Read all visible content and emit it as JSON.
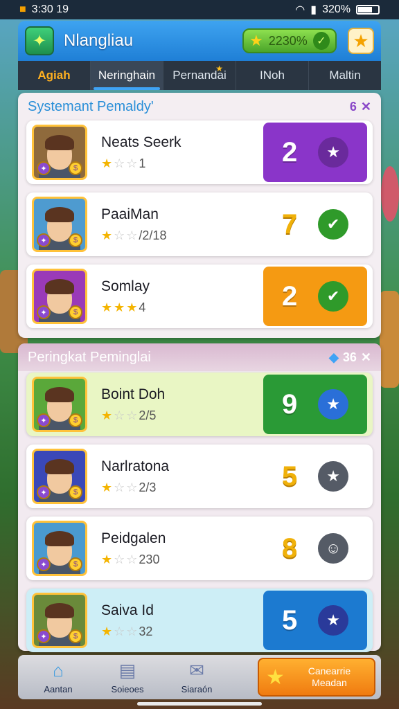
{
  "status": {
    "time": "3:30 19",
    "battery": "320%"
  },
  "header": {
    "title": "Nlangliau",
    "currency_value": "2230%",
    "app_icon": "leaf-star-icon",
    "fav_icon": "star-icon"
  },
  "tabs": [
    {
      "label": "Agiah"
    },
    {
      "label": "Neringhain"
    },
    {
      "label": "Pernandai"
    },
    {
      "label": "INoh"
    },
    {
      "label": "Maltin"
    }
  ],
  "panel1": {
    "title": "Systemant Pemaldy'",
    "close_count": "6",
    "rows": [
      {
        "name": "Neats Seerk",
        "rating": "1",
        "stars": 1,
        "score": "2",
        "score_color": "#8a35c9",
        "medal_color": "#6a2a9c",
        "medal_icon": "star-icon",
        "boxed": true,
        "avatar_bg": "#8f6a3c"
      },
      {
        "name": "PaaiMan",
        "rating": "/2/18",
        "stars": 1,
        "score": "7",
        "score_color": "",
        "medal_color": "#2f9a2a",
        "medal_icon": "check-icon",
        "boxed": false,
        "avatar_bg": "#4e9bd0"
      },
      {
        "name": "Somlay",
        "rating": "4",
        "stars": 3,
        "score": "2",
        "score_color": "#f59a12",
        "medal_color": "#2f9a2a",
        "medal_icon": "check-icon",
        "boxed": true,
        "avatar_bg": "#9a3ab8"
      }
    ]
  },
  "panel2": {
    "title": "Peringkat Peminglai",
    "close_count": "36",
    "rows": [
      {
        "name": "Boint Doh",
        "rating": "2/5",
        "stars": 1,
        "score": "9",
        "score_color": "#2a9a36",
        "medal_color": "#2a6fd8",
        "medal_icon": "star-icon",
        "boxed": true,
        "avatar_bg": "#5aa83a"
      },
      {
        "name": "Narlratona",
        "rating": "2/3",
        "stars": 1,
        "score": "5",
        "score_color": "",
        "medal_color": "#555b66",
        "medal_icon": "star-icon",
        "boxed": false,
        "avatar_bg": "#3a48b8"
      },
      {
        "name": "Peidgalen",
        "rating": "230",
        "stars": 1,
        "score": "8",
        "score_color": "",
        "medal_color": "#555b66",
        "medal_icon": "face-icon",
        "boxed": false,
        "avatar_bg": "#4a9ad0"
      },
      {
        "name": "Saiva Id",
        "rating": "32",
        "stars": 1,
        "score": "5",
        "score_color": "#1c7ad0",
        "medal_color": "#2a3a9a",
        "medal_icon": "star-icon",
        "boxed": true,
        "avatar_bg": "#6a8a3a"
      }
    ]
  },
  "nav": {
    "items": [
      {
        "label": "Aantan",
        "icon": "home-icon"
      },
      {
        "label": "Soieoes",
        "icon": "chat-icon"
      },
      {
        "label": "Siaraón",
        "icon": "message-icon"
      }
    ],
    "cta_label": "Canearrie Meadan",
    "cta_icon": "star-icon"
  }
}
